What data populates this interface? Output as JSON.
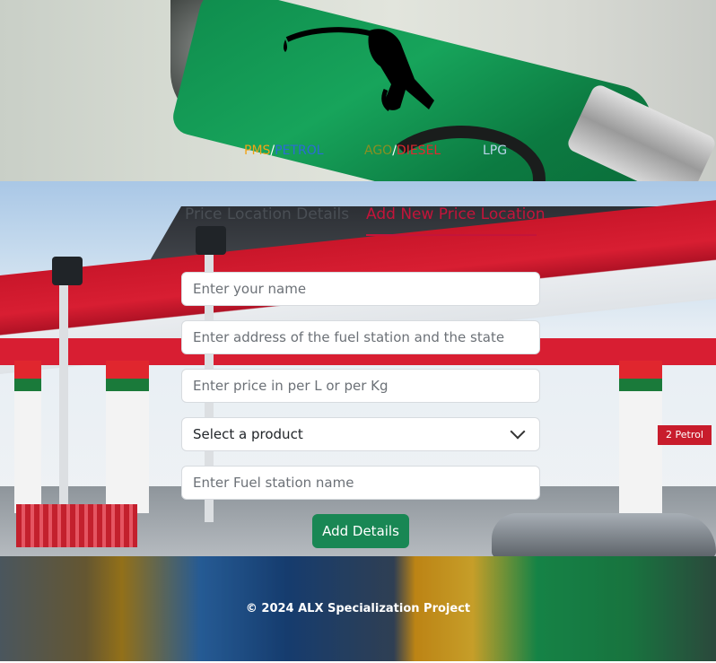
{
  "hero": {
    "nav": [
      {
        "parts": [
          {
            "text": "PMS",
            "color": "#f0a417"
          },
          {
            "text": "/",
            "color": "#ffffff"
          },
          {
            "text": "PETROL",
            "color": "#2c6bd6"
          }
        ]
      },
      {
        "parts": [
          {
            "text": "AGO",
            "color": "#8a8f22"
          },
          {
            "text": "/",
            "color": "#ffffff"
          },
          {
            "text": "DIESEL",
            "color": "#e0292f"
          }
        ]
      },
      {
        "parts": [
          {
            "text": "LPG",
            "color": "#b9d4ea"
          }
        ]
      }
    ]
  },
  "tabs": {
    "details_label": "Price Location Details",
    "add_label": "Add New Price Location",
    "active": "add"
  },
  "form": {
    "name_placeholder": "Enter your name",
    "address_placeholder": "Enter address of the fuel station and the state",
    "price_placeholder": "Enter price in per L or per Kg",
    "product_selected": "Select a product",
    "station_placeholder": "Enter Fuel station name",
    "submit_label": "Add Details"
  },
  "station_sign": "2 Petrol",
  "footer": {
    "text": "© 2024 ALX Specialization Project"
  },
  "colors": {
    "accent": "#c4143a",
    "button": "#198754"
  }
}
